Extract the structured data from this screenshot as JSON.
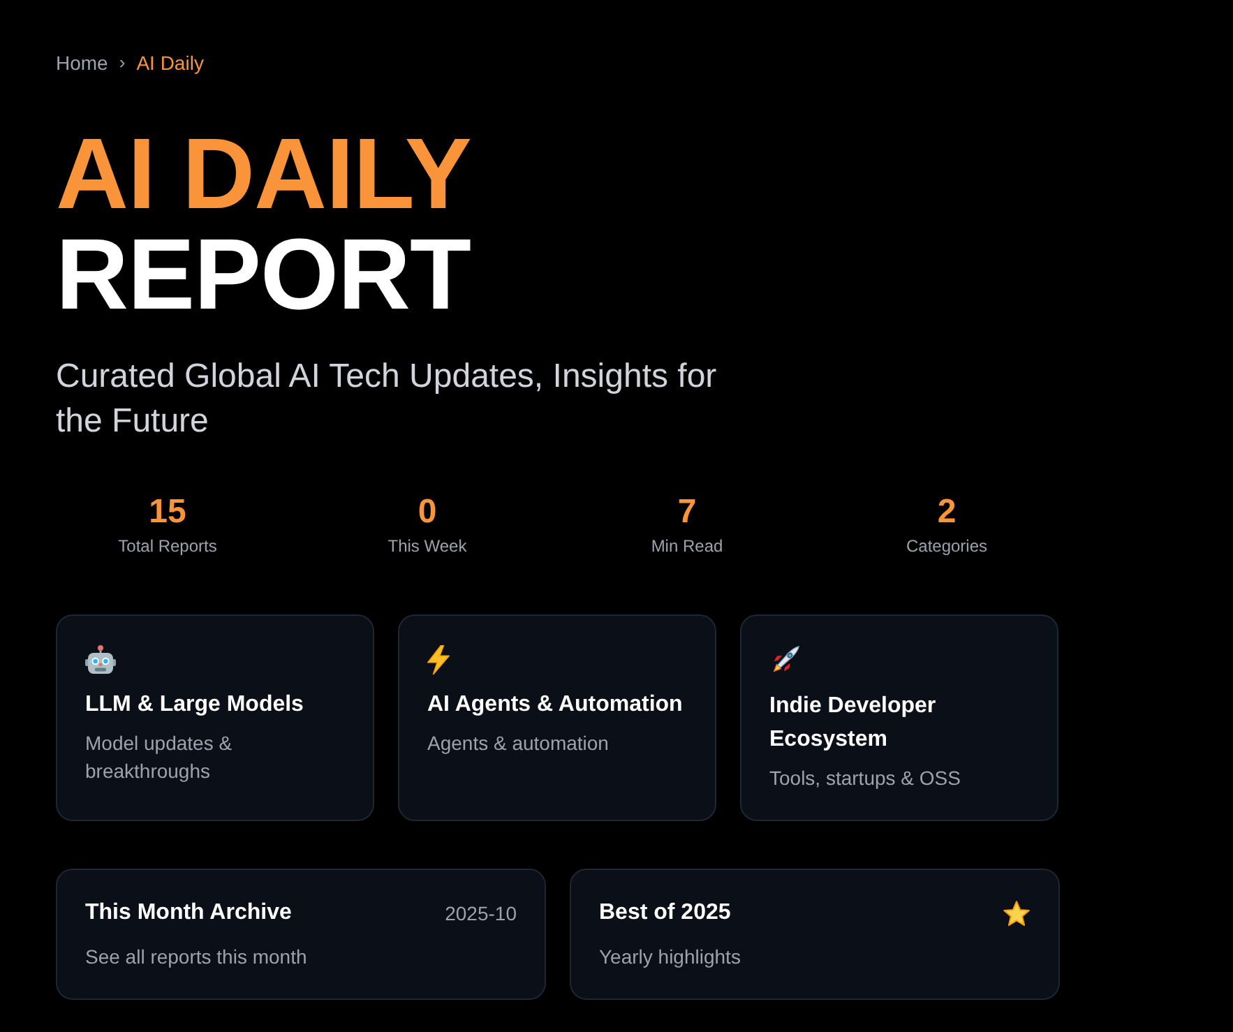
{
  "breadcrumb": {
    "items": [
      {
        "label": "Home",
        "current": false
      },
      {
        "label": "AI Daily",
        "current": true
      }
    ],
    "separator": "›"
  },
  "hero": {
    "title_lines": [
      {
        "text": "AI DAILY",
        "accent": true
      },
      {
        "text": "REPORT",
        "accent": false
      }
    ],
    "subtitle": "Curated Global AI Tech Updates, Insights for the Future"
  },
  "stats": [
    {
      "value": "15",
      "label": "Total Reports"
    },
    {
      "value": "0",
      "label": "This Week"
    },
    {
      "value": "7",
      "label": "Min Read"
    },
    {
      "value": "2",
      "label": "Categories"
    }
  ],
  "categories": [
    {
      "title": "LLM & Large Models",
      "description": "Model updates & breakthroughs"
    },
    {
      "title": "AI Agents & Automation",
      "description": "Agents & automation"
    },
    {
      "title": "Indie Developer Ecosystem",
      "description": "Tools, startups & OSS"
    }
  ],
  "archive_cards": [
    {
      "kind": "archive",
      "title": "This Month Archive",
      "date": "2025-10",
      "description": "See all reports this month"
    },
    {
      "kind": "featured",
      "title": "Best of 2025",
      "description": "Yearly highlights"
    }
  ]
}
